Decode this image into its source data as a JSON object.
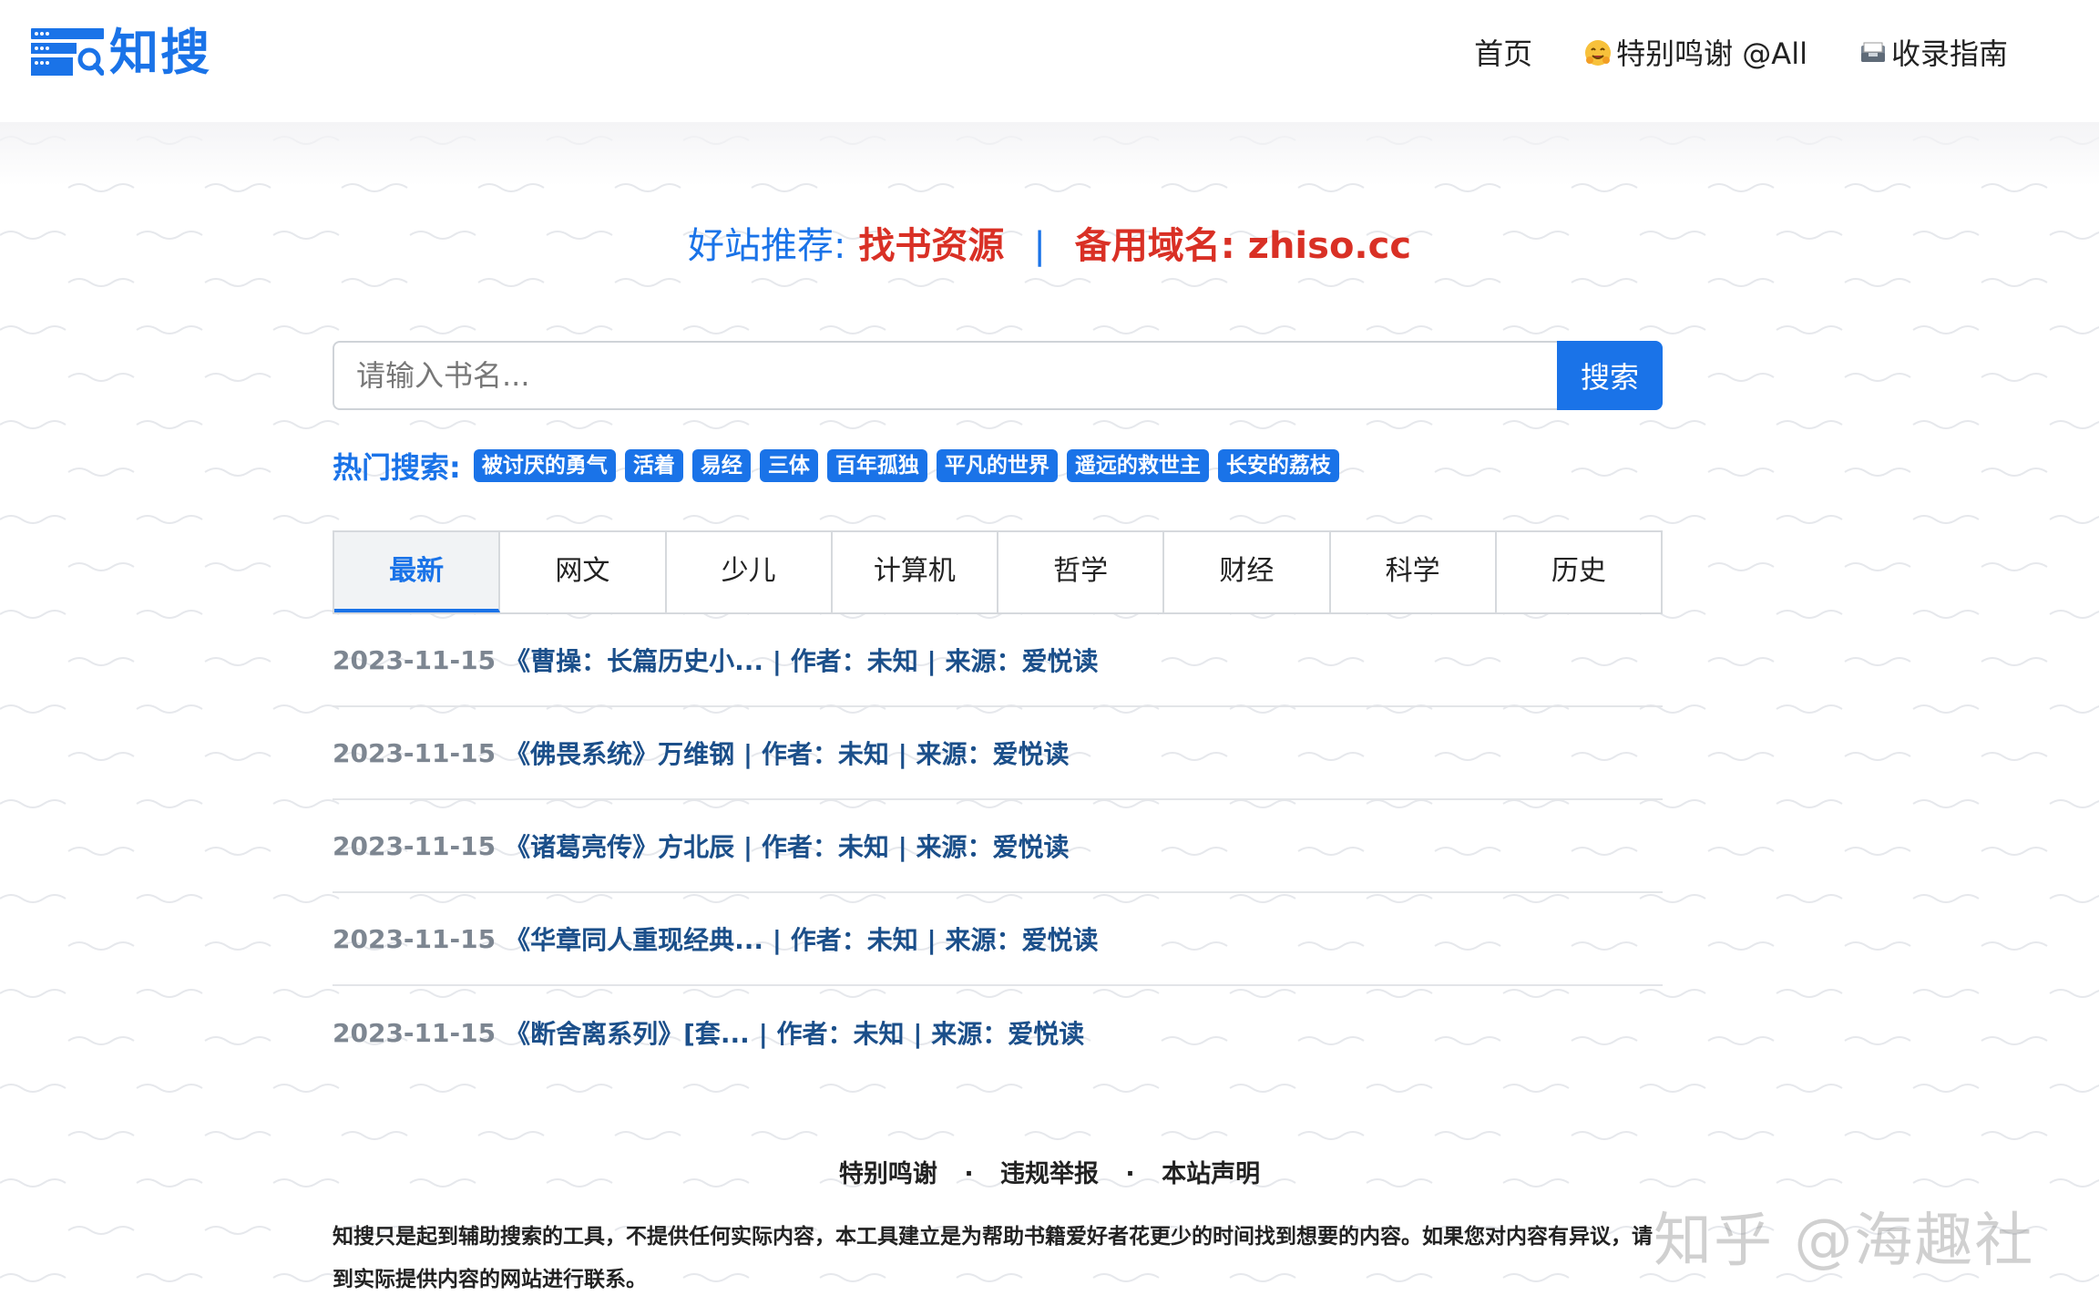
{
  "header": {
    "logo_text": "知搜",
    "nav": [
      {
        "label": "首页"
      },
      {
        "label": "特别鸣谢 @All",
        "icon": "hugging-face-emoji-icon"
      },
      {
        "label": "收录指南",
        "icon": "inbox-tray-icon"
      }
    ]
  },
  "promo": {
    "prefix": "好站推荐:",
    "site": "找书资源",
    "separator": "|",
    "backup_label": "备用域名:",
    "backup_domain": "zhiso.cc"
  },
  "search": {
    "placeholder": "请输入书名...",
    "button_label": "搜索"
  },
  "hot": {
    "label": "热门搜索:",
    "tags": [
      "被讨厌的勇气",
      "活着",
      "易经",
      "三体",
      "百年孤独",
      "平凡的世界",
      "遥远的救世主",
      "长安的荔枝"
    ]
  },
  "tabs": [
    {
      "label": "最新",
      "active": true
    },
    {
      "label": "网文"
    },
    {
      "label": "少儿"
    },
    {
      "label": "计算机"
    },
    {
      "label": "哲学"
    },
    {
      "label": "财经"
    },
    {
      "label": "科学"
    },
    {
      "label": "历史"
    }
  ],
  "list": [
    {
      "date": "2023-11-15",
      "title": "《曹操：长篇历史小... | 作者：未知 | 来源：爱悦读"
    },
    {
      "date": "2023-11-15",
      "title": "《佛畏系统》万维钢 | 作者：未知 | 来源：爱悦读"
    },
    {
      "date": "2023-11-15",
      "title": "《诸葛亮传》方北辰 | 作者：未知 | 来源：爱悦读"
    },
    {
      "date": "2023-11-15",
      "title": "《华章同人重现经典... | 作者：未知 | 来源：爱悦读"
    },
    {
      "date": "2023-11-15",
      "title": "《断舍离系列》[套... | 作者：未知 | 来源：爱悦读"
    }
  ],
  "footer": {
    "links": [
      "特别鸣谢",
      "违规举报",
      "本站声明"
    ],
    "separator": "·",
    "disclaimer": "知搜只是起到辅助搜索的工具，不提供任何实际内容，本工具建立是为帮助书籍爱好者花更少的时间找到想要的内容。如果您对内容有异议，请到实际提供内容的网站进行联系。"
  },
  "watermark": "知乎 @海趣社",
  "colors": {
    "brand_blue": "#1a73e8",
    "promo_red": "#d93025",
    "list_title": "#1b4f8a",
    "list_date": "#7d8691"
  }
}
